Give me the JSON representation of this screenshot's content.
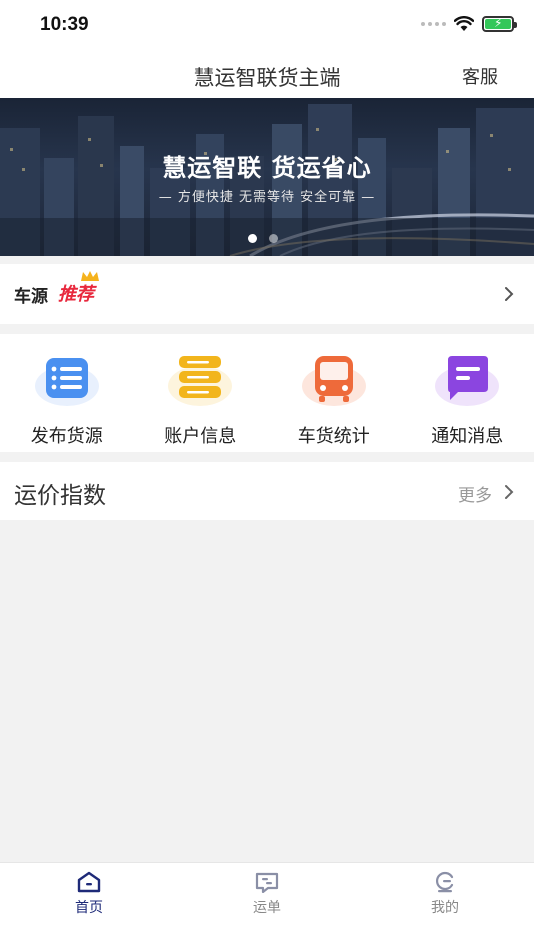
{
  "status_bar": {
    "time": "10:39"
  },
  "nav": {
    "title": "慧运智联货主端",
    "service": "客服"
  },
  "banner": {
    "title": "慧运智联  货运省心",
    "subtitle": "— 方便快捷  无需等待  安全可靠 —",
    "slide_count": 2,
    "active_slide": 1
  },
  "source": {
    "label": "车源",
    "tag": "推荐"
  },
  "actions": [
    {
      "label": "发布货源",
      "icon": "list-icon",
      "color": "#4a90f0"
    },
    {
      "label": "账户信息",
      "icon": "database-icon",
      "color": "#f2b51c"
    },
    {
      "label": "车货统计",
      "icon": "bus-icon",
      "color": "#ee6a3a"
    },
    {
      "label": "通知消息",
      "icon": "message-icon",
      "color": "#8b45e0"
    }
  ],
  "rate": {
    "title": "运价指数",
    "more": "更多"
  },
  "tabs": [
    {
      "label": "首页",
      "icon": "home-icon",
      "active": true
    },
    {
      "label": "运单",
      "icon": "waybill-icon",
      "active": false
    },
    {
      "label": "我的",
      "icon": "profile-icon",
      "active": false
    }
  ],
  "colors": {
    "accent": "#1e2a78",
    "tag_red": "#e8283d",
    "background": "#f2f2f2"
  }
}
